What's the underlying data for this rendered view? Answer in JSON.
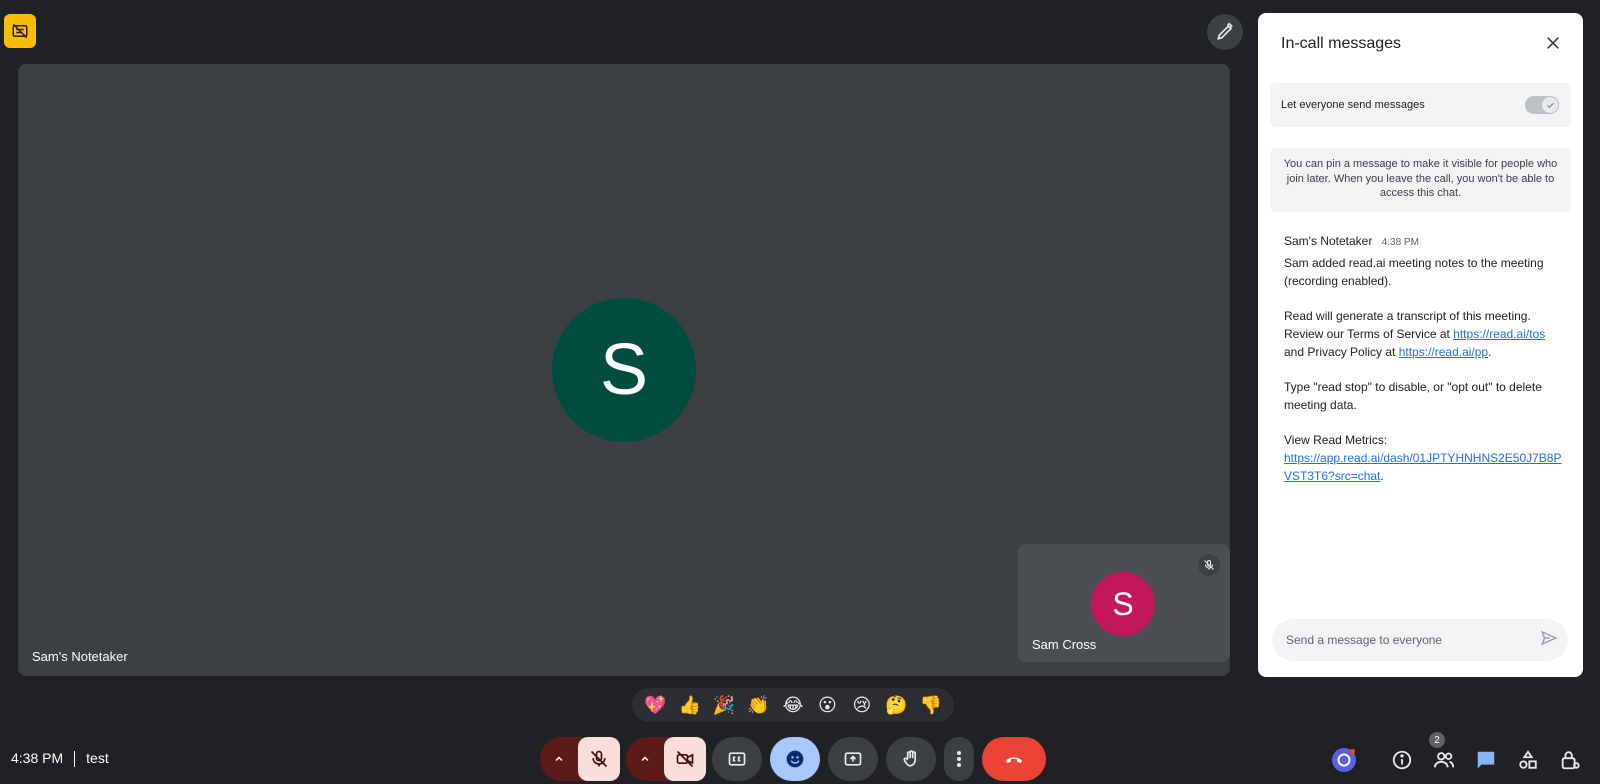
{
  "colors": {
    "background": "#202124",
    "tile": "#3c4043",
    "main_avatar": "#004d40",
    "self_avatar": "#c2185b",
    "hangup": "#ea4335",
    "link": "#1a73e8",
    "badge": "#fbbc04"
  },
  "main": {
    "participant_name": "Sam's Notetaker",
    "avatar_letter": "S"
  },
  "self": {
    "participant_name": "Sam Cross",
    "avatar_letter": "S"
  },
  "panel": {
    "title": "In-call messages",
    "toggle_label": "Let everyone send messages",
    "info": "You can pin a message to make it visible for people who join later. When you leave the call, you won't be able to access this chat.",
    "message": {
      "sender": "Sam's Notetaker",
      "time": "4:38 PM",
      "p1": "Sam added read.ai meeting notes to the meeting (recording enabled).",
      "p2_a": "Read will generate a transcript of this meeting. Review our Terms of Service at ",
      "tos_link": "https://read.ai/tos",
      "p2_b": " and Privacy Policy at ",
      "pp_link": "https://read.ai/pp",
      "p2_c": ".",
      "p3": "Type \"read stop\" to disable, or \"opt out\" to delete meeting data.",
      "p4": "View Read Metrics:",
      "metrics_link": "https://app.read.ai/dash/01JPTYHNHNS2E50J7B8PVST3T6?src=chat",
      "p4_end": "."
    },
    "composer_placeholder": "Send a message to everyone"
  },
  "reactions": [
    "💖",
    "👍",
    "🎉",
    "👏",
    "😂",
    "😮",
    "😢",
    "🤔",
    "👎"
  ],
  "bottom": {
    "time": "4:38 PM",
    "meeting_name": "test",
    "people_count": "2"
  },
  "icons": {
    "rec": "no-recording-icon",
    "pen": "pen-icon",
    "close": "close-icon",
    "mic_off": "mic-off-icon",
    "cam_off": "camera-off-icon",
    "captions": "captions-icon",
    "emoji": "emoji-icon",
    "present": "present-icon",
    "hand": "raise-hand-icon",
    "more": "more-vert-icon",
    "hangup": "hang-up-icon",
    "info": "info-icon",
    "people": "people-icon",
    "chat": "chat-icon",
    "activities": "activities-icon",
    "host": "host-controls-icon",
    "send": "send-icon"
  }
}
